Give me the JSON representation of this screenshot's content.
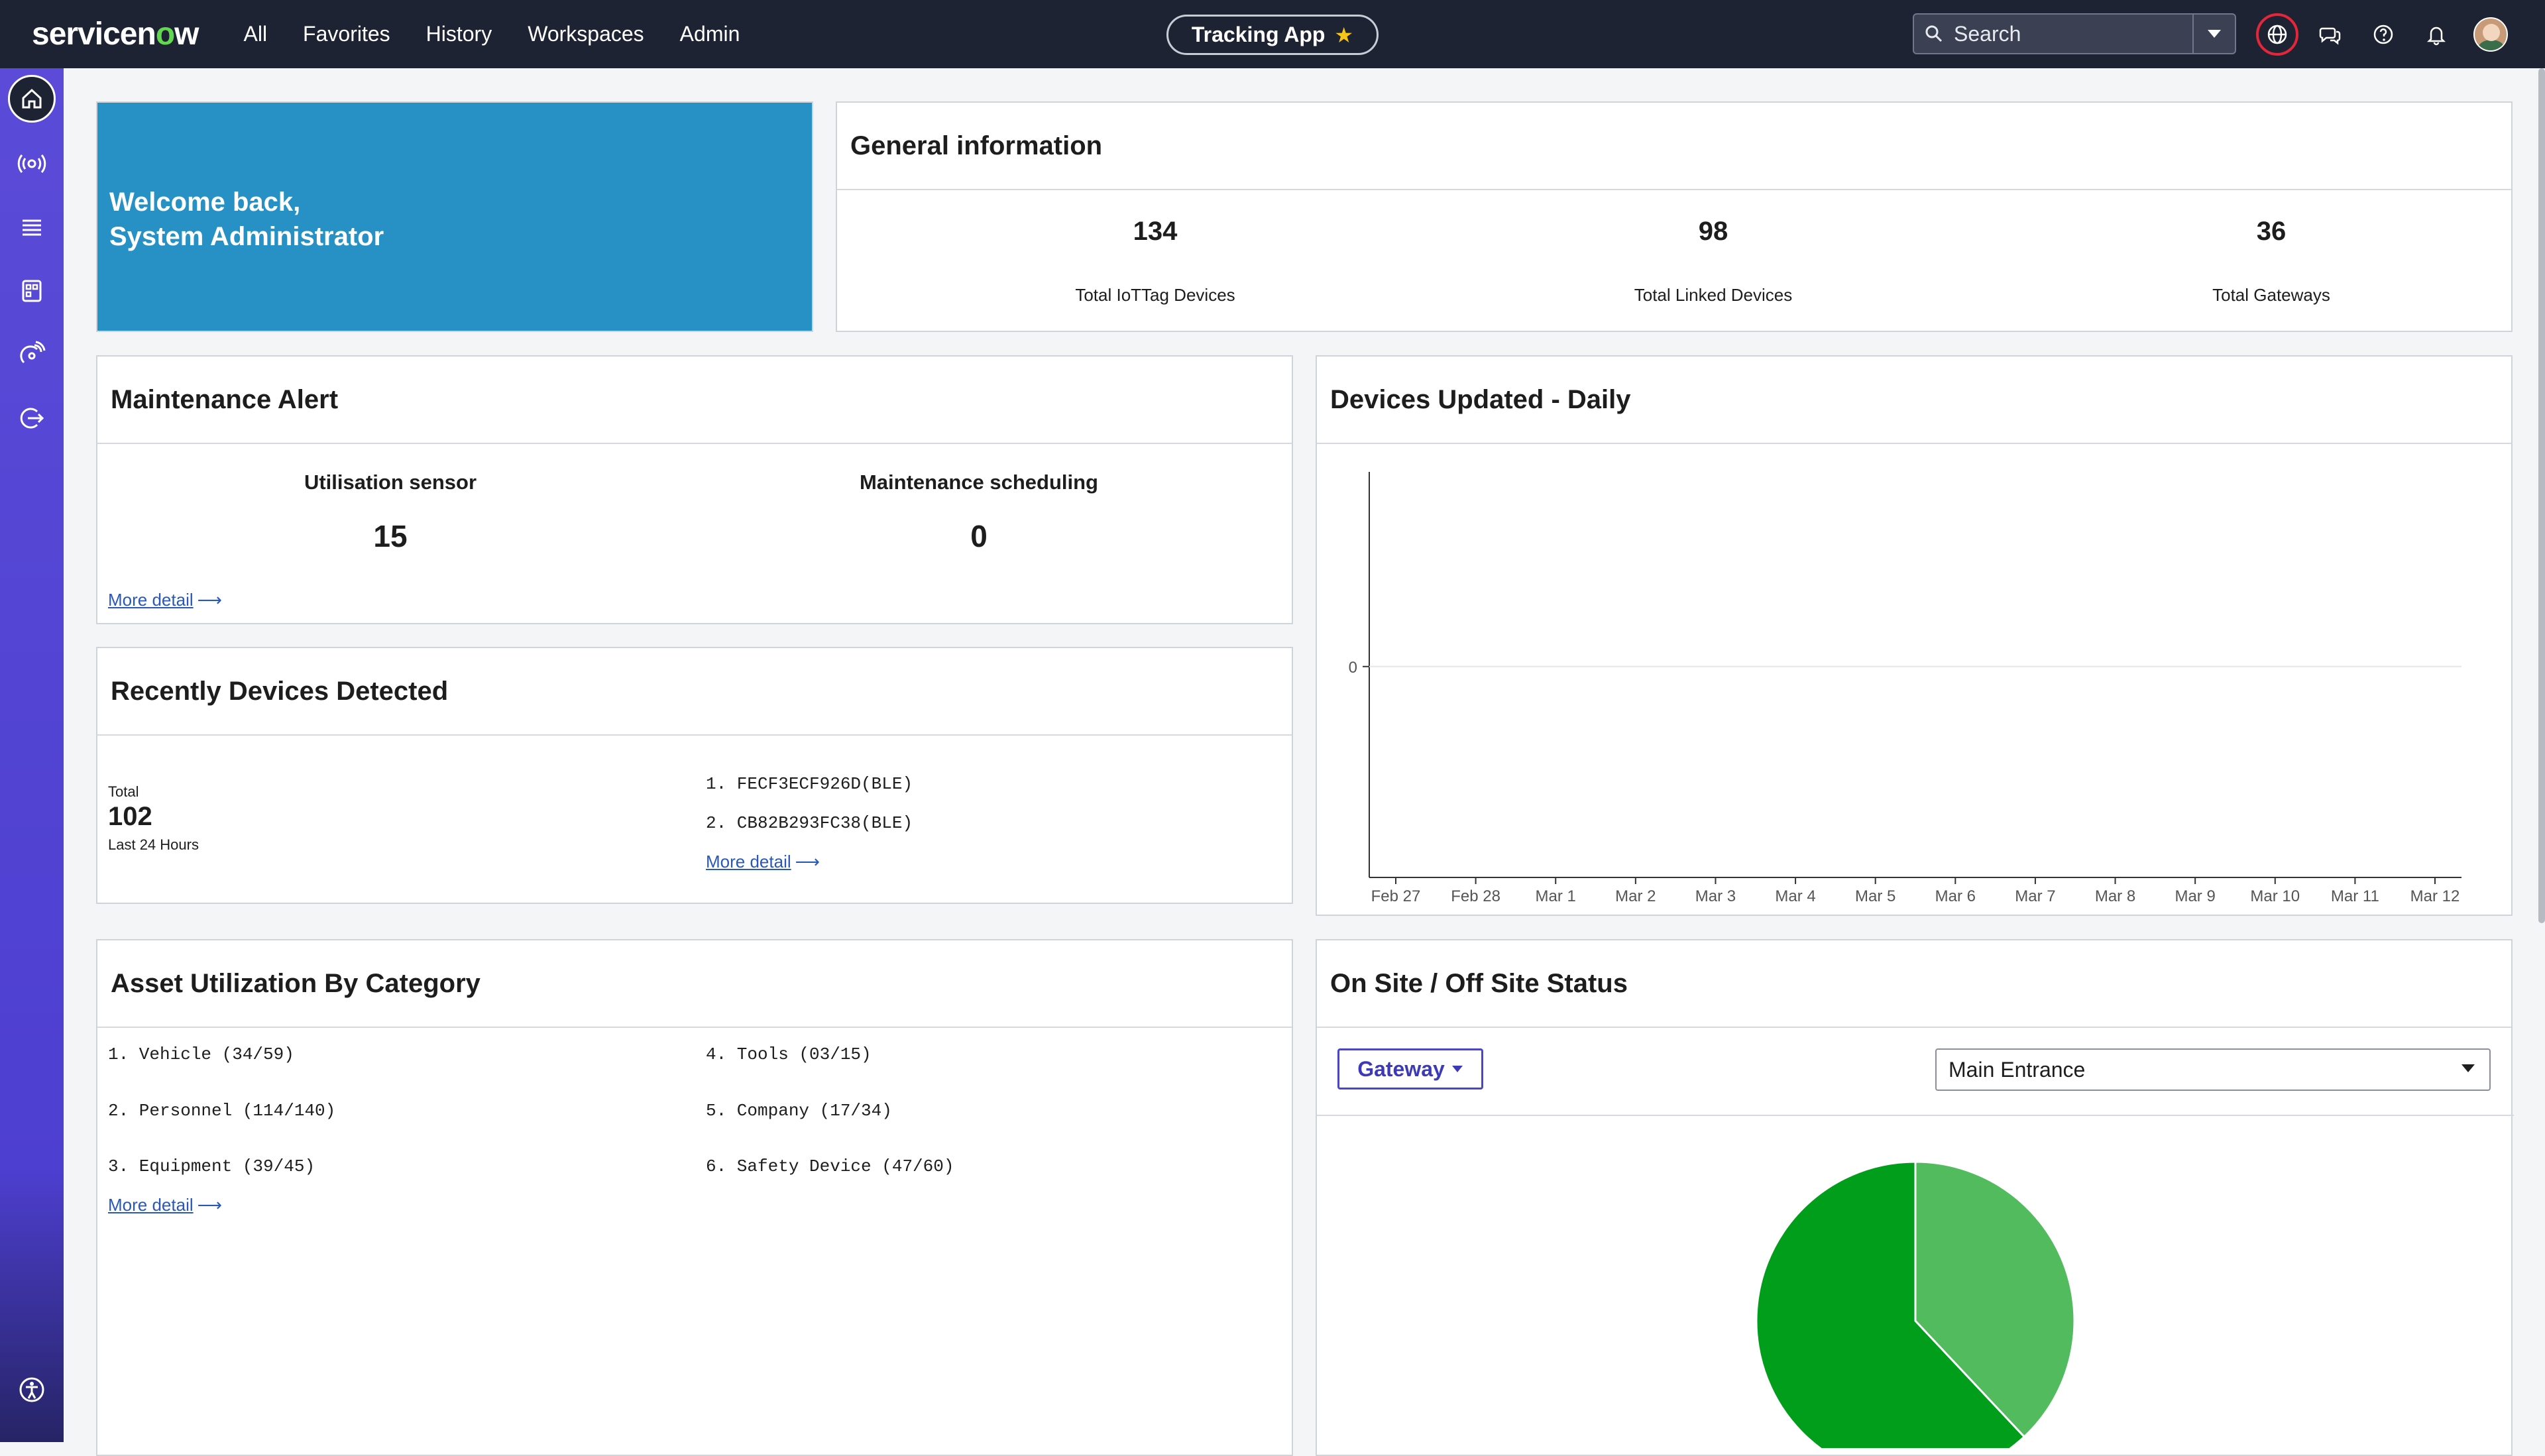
{
  "header": {
    "logo_text_1": "servicen",
    "logo_text_o": "o",
    "logo_text_2": "w",
    "nav": [
      "All",
      "Favorites",
      "History",
      "Workspaces",
      "Admin"
    ],
    "app_name": "Tracking App",
    "search_placeholder": "Search"
  },
  "welcome": {
    "line1": "Welcome back,",
    "line2": "System Administrator"
  },
  "general": {
    "title": "General information",
    "stats": [
      {
        "value": "134",
        "label": "Total IoTTag Devices"
      },
      {
        "value": "98",
        "label": "Total Linked Devices"
      },
      {
        "value": "36",
        "label": "Total Gateways"
      }
    ]
  },
  "maintenance": {
    "title": "Maintenance Alert",
    "items": [
      {
        "label": "Utilisation sensor",
        "value": "15"
      },
      {
        "label": "Maintenance scheduling",
        "value": "0"
      }
    ],
    "link": "More detail"
  },
  "recent": {
    "title": "Recently Devices Detected",
    "total_label": "Total",
    "total_value": "102",
    "period": "Last 24 Hours",
    "devices": [
      "1. FECF3ECF926D(BLE)",
      "2. CB82B293FC38(BLE)"
    ],
    "link": "More detail"
  },
  "asset": {
    "title": "Asset Utilization By Category",
    "items": [
      "1. Vehicle (34/59)",
      "2. Personnel (114/140)",
      "3. Equipment (39/45)",
      "4. Tools (03/15)",
      "5. Company (17/34)",
      "6. Safety Device (47/60)"
    ],
    "link": "More detail"
  },
  "status": {
    "title": "On Site / Off Site Status",
    "gateway_label": "Gateway",
    "location": "Main Entrance"
  },
  "chart_data": [
    {
      "type": "line",
      "title": "Devices Updated - Daily",
      "x": [
        "Feb 27",
        "Feb 28",
        "Mar 1",
        "Mar 2",
        "Mar 3",
        "Mar 4",
        "Mar 5",
        "Mar 6",
        "Mar 7",
        "Mar 8",
        "Mar 9",
        "Mar 10",
        "Mar 11",
        "Mar 12"
      ],
      "series": [
        {
          "values": [
            0,
            0,
            0,
            0,
            0,
            0,
            0,
            0,
            0,
            0,
            0,
            0,
            0,
            0
          ]
        }
      ],
      "yticks": [
        "0"
      ],
      "grid": true
    },
    {
      "type": "pie",
      "slices": [
        {
          "fraction": 0.62,
          "color": "#019e1b"
        },
        {
          "fraction": 0.38,
          "color": "#52bb5e"
        }
      ]
    }
  ]
}
